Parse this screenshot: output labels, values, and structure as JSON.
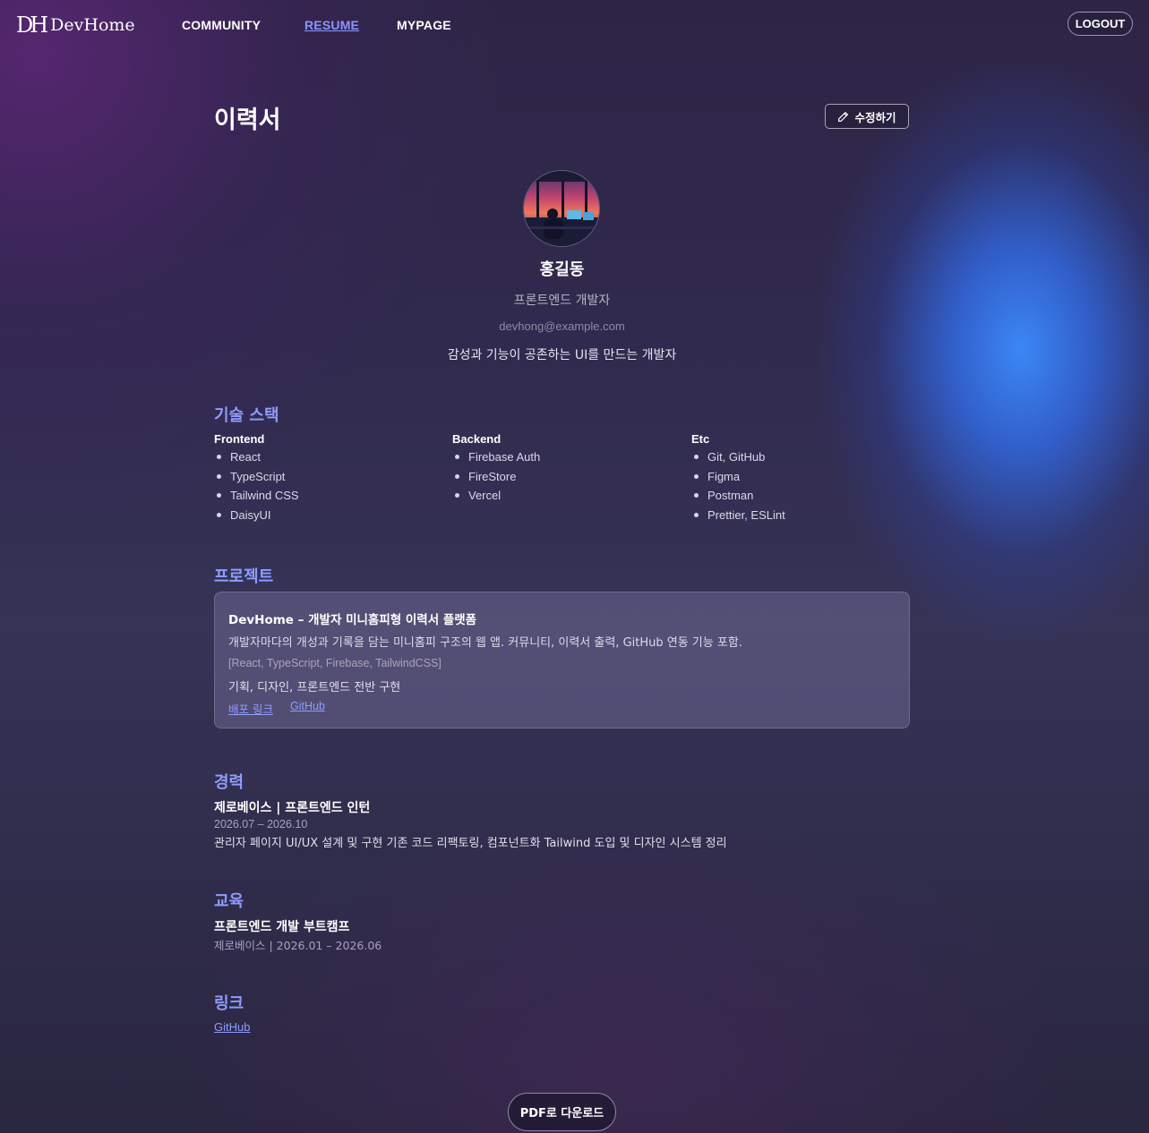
{
  "header": {
    "logo_mark": "DH",
    "logo_text": "DevHome",
    "nav": [
      "COMMUNITY",
      "RESUME",
      "MYPAGE"
    ],
    "active_nav": "RESUME",
    "logout_label": "LOGOUT"
  },
  "page": {
    "title": "이력서",
    "edit_label": "수정하기"
  },
  "profile": {
    "name": "홍길동",
    "role": "프론트엔드 개발자",
    "email": "devhong@example.com",
    "intro": "감성과 기능이 공존하는 UI를 만드는 개발자"
  },
  "skills": {
    "title": "기술 스택",
    "columns": [
      {
        "name": "Frontend",
        "items": [
          "React",
          "TypeScript",
          "Tailwind CSS",
          "DaisyUI"
        ]
      },
      {
        "name": "Backend",
        "items": [
          "Firebase Auth",
          "FireStore",
          "Vercel"
        ]
      },
      {
        "name": "Etc",
        "items": [
          "Git, GitHub",
          "Figma",
          "Postman",
          "Prettier, ESLint"
        ]
      }
    ]
  },
  "projects": {
    "title": "프로젝트",
    "items": [
      {
        "title": "DevHome – 개발자 미니홈피형 이력서 플랫폼",
        "description": "개발자마다의 개성과 기록을 담는 미니홈피 구조의 웹 앱. 커뮤니티, 이력서 출력, GitHub 연동 기능 포함.",
        "tech": "[React, TypeScript, Firebase, TailwindCSS]",
        "role": "기획, 디자인, 프론트엔드 전반 구현",
        "links": [
          "배포 링크",
          "GitHub"
        ]
      }
    ]
  },
  "career": {
    "title": "경력",
    "items": [
      {
        "title": "제로베이스 | 프론트엔드 인턴",
        "period": "2026.07 – 2026.10",
        "description": "관리자 페이지 UI/UX 설계 및 구현 기존 코드 리팩토링, 컴포넌트화 Tailwind 도입 및 디자인 시스템 정리"
      }
    ]
  },
  "education": {
    "title": "교육",
    "items": [
      {
        "title": "프론트엔드 개발 부트캠프",
        "sub": "제로베이스 | 2026.01 – 2026.06"
      }
    ]
  },
  "links": {
    "title": "링크",
    "items": [
      "GitHub"
    ]
  },
  "pdf_label": "PDF로 다운로드",
  "colors": {
    "accent": "#8f9cff",
    "glow": "#3c8cff",
    "background": "#302a4e"
  }
}
